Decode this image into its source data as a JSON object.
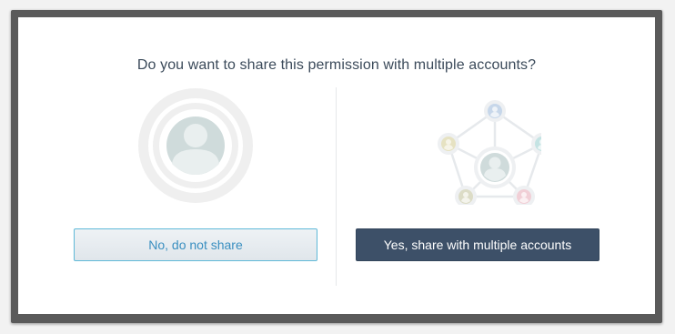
{
  "dialog": {
    "question": "Do you want to share this permission with multiple accounts?",
    "no_label": "No, do not share",
    "yes_label": "Yes, share with multiple accounts"
  },
  "icons": {
    "single": "single-account-icon",
    "multi": "multiple-accounts-network-icon"
  },
  "colors": {
    "yes_button": "#3d5068",
    "no_button_border": "#5fb9d8",
    "no_button_text": "#3a8fc0",
    "frame": "#5a5a5a"
  }
}
